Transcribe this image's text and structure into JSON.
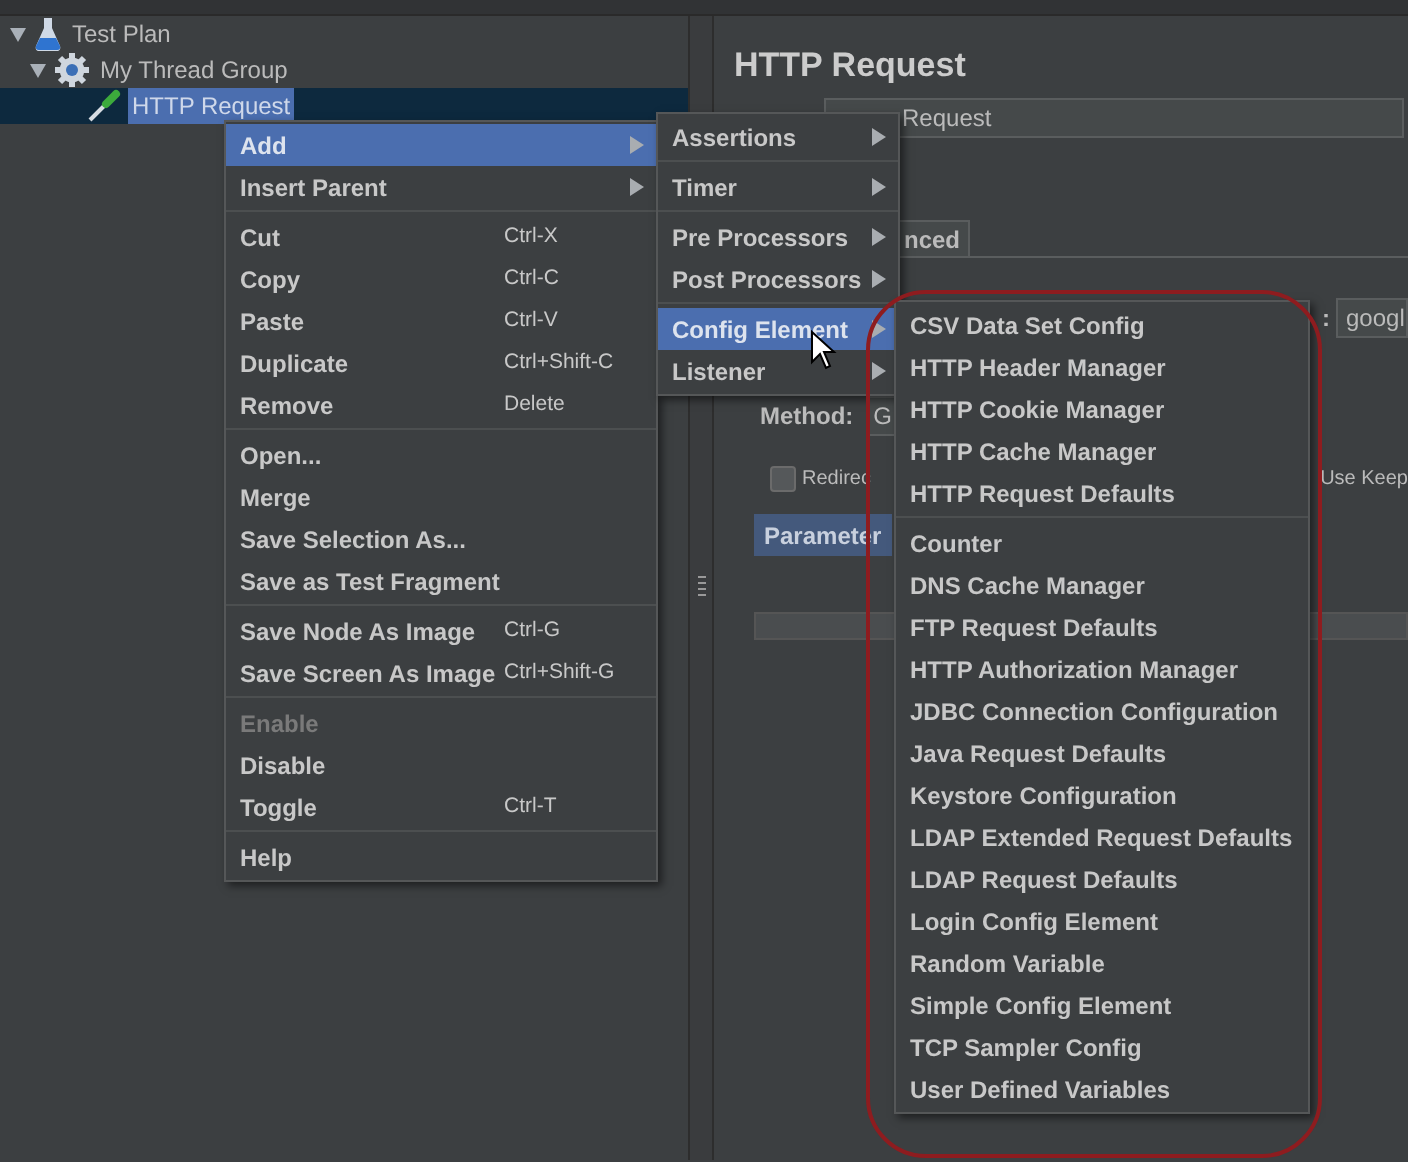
{
  "tree": [
    {
      "label": "Test Plan",
      "kind": "plan",
      "expanded": true,
      "selected": false,
      "children": [
        {
          "label": "My Thread Group",
          "kind": "group",
          "expanded": true,
          "selected": false,
          "children": [
            {
              "label": "HTTP Request",
              "kind": "sampler",
              "selected": true
            }
          ]
        }
      ]
    }
  ],
  "editor": {
    "title": "HTTP Request",
    "name_value": "Request",
    "tab_fragment": "nced",
    "server_label_fragment": ":",
    "server_value": "googl",
    "method_label": "Method:",
    "method_value": "G",
    "redirect": {
      "label": "Redirec",
      "checked": false
    },
    "keepalive_label": "Use Keep",
    "params_tab": "Parameter"
  },
  "context_menu": [
    [
      {
        "label": "Add",
        "has_submenu": true,
        "selected": true,
        "disabled": false
      },
      {
        "label": "Insert Parent",
        "has_submenu": true,
        "selected": false,
        "disabled": false
      }
    ],
    [
      {
        "label": "Cut",
        "shortcut": "Ctrl-X",
        "has_submenu": false,
        "selected": false,
        "disabled": false
      },
      {
        "label": "Copy",
        "shortcut": "Ctrl-C",
        "has_submenu": false,
        "selected": false,
        "disabled": false
      },
      {
        "label": "Paste",
        "shortcut": "Ctrl-V",
        "has_submenu": false,
        "selected": false,
        "disabled": false
      },
      {
        "label": "Duplicate",
        "shortcut": "Ctrl+Shift-C",
        "has_submenu": false,
        "selected": false,
        "disabled": false
      },
      {
        "label": "Remove",
        "shortcut": "Delete",
        "has_submenu": false,
        "selected": false,
        "disabled": false
      }
    ],
    [
      {
        "label": "Open...",
        "has_submenu": false,
        "selected": false,
        "disabled": false
      },
      {
        "label": "Merge",
        "has_submenu": false,
        "selected": false,
        "disabled": false
      },
      {
        "label": "Save Selection As...",
        "has_submenu": false,
        "selected": false,
        "disabled": false
      },
      {
        "label": "Save as Test Fragment",
        "has_submenu": false,
        "selected": false,
        "disabled": false
      }
    ],
    [
      {
        "label": "Save Node As Image",
        "shortcut": "Ctrl-G",
        "has_submenu": false,
        "selected": false,
        "disabled": false
      },
      {
        "label": "Save Screen As Image",
        "shortcut": "Ctrl+Shift-G",
        "has_submenu": false,
        "selected": false,
        "disabled": false
      }
    ],
    [
      {
        "label": "Enable",
        "has_submenu": false,
        "selected": false,
        "disabled": true
      },
      {
        "label": "Disable",
        "has_submenu": false,
        "selected": false,
        "disabled": false
      },
      {
        "label": "Toggle",
        "shortcut": "Ctrl-T",
        "has_submenu": false,
        "selected": false,
        "disabled": false
      }
    ],
    [
      {
        "label": "Help",
        "has_submenu": false,
        "selected": false,
        "disabled": false
      }
    ]
  ],
  "add_submenu": [
    [
      {
        "label": "Assertions",
        "selected": false
      }
    ],
    [
      {
        "label": "Timer",
        "selected": false
      }
    ],
    [
      {
        "label": "Pre Processors",
        "selected": false
      },
      {
        "label": "Post Processors",
        "selected": false
      }
    ],
    [
      {
        "label": "Config Element",
        "selected": true
      },
      {
        "label": "Listener",
        "selected": false
      }
    ]
  ],
  "config_submenu": [
    [
      {
        "label": "CSV Data Set Config"
      },
      {
        "label": "HTTP Header Manager"
      },
      {
        "label": "HTTP Cookie Manager"
      },
      {
        "label": "HTTP Cache Manager"
      },
      {
        "label": "HTTP Request Defaults"
      }
    ],
    [
      {
        "label": "Counter"
      },
      {
        "label": "DNS Cache Manager"
      },
      {
        "label": "FTP Request Defaults"
      },
      {
        "label": "HTTP Authorization Manager"
      },
      {
        "label": "JDBC Connection Configuration"
      },
      {
        "label": "Java Request Defaults"
      },
      {
        "label": "Keystore Configuration"
      },
      {
        "label": "LDAP Extended Request Defaults"
      },
      {
        "label": "LDAP Request Defaults"
      },
      {
        "label": "Login Config Element"
      },
      {
        "label": "Random Variable"
      },
      {
        "label": "Simple Config Element"
      },
      {
        "label": "TCP Sampler Config"
      },
      {
        "label": "User Defined Variables"
      }
    ]
  ]
}
